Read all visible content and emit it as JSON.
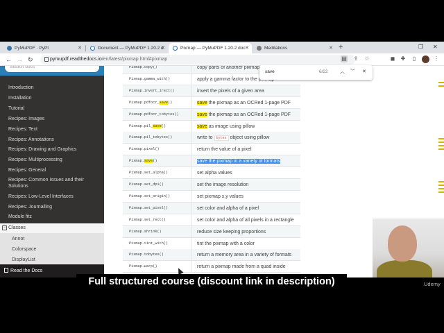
{
  "browser": {
    "tabs": [
      {
        "label": "PyMuPDF · PyPI"
      },
      {
        "label": "Document — PyMuPDF 1.20.2 d"
      },
      {
        "label": "Pixmap — PyMuPDF 1.20.2 doc"
      },
      {
        "label": "Meditations"
      }
    ],
    "url_host": "pymupdf.readthedocs.io",
    "url_path": "/en/latest/pixmap.html#pixmap",
    "new_tab_label": "+"
  },
  "find_bar": {
    "query": "save",
    "count": "6/22"
  },
  "sidebar": {
    "search_placeholder": "Search docs",
    "items": [
      {
        "label": "Introduction"
      },
      {
        "label": "Installation"
      },
      {
        "label": "Tutorial"
      },
      {
        "label": "Recipes: Images"
      },
      {
        "label": "Recipes: Text"
      },
      {
        "label": "Recipes: Annotations"
      },
      {
        "label": "Recipes: Drawing and Graphics"
      },
      {
        "label": "Recipes: Multiprocessing"
      },
      {
        "label": "Recipes: General"
      },
      {
        "label": "Recipes: Common Issues and their Solutions"
      },
      {
        "label": "Recipes: Low-Level Interfaces"
      },
      {
        "label": "Recipes: Journalling"
      },
      {
        "label": "Module fitz"
      }
    ],
    "classes_label": "Classes",
    "toggle_symbol": "−",
    "sub_items": [
      {
        "label": "Annot"
      },
      {
        "label": "Colorspace"
      },
      {
        "label": "DisplayList"
      }
    ],
    "read_the_docs": "Read the Docs"
  },
  "methods_table": {
    "rows": [
      {
        "name": "Pixmap.copy()",
        "pre": "copy parts of another pixmap",
        "hl": "",
        "post": "",
        "highlight": "none"
      },
      {
        "name": "Pixmap.gamma_with()",
        "pre": "apply a gamma factor to the pixmap",
        "hl": "",
        "post": "",
        "highlight": "none"
      },
      {
        "name": "Pixmap.invert_irect()",
        "pre": "invert the pixels of a given area",
        "hl": "",
        "post": "",
        "highlight": "none"
      },
      {
        "name_pre": "Pixmap.pdfocr_",
        "name_hl": "save",
        "name_post": "()",
        "pre": "",
        "hl": "save",
        "post": " the pixmap as an OCRed 1-page PDF",
        "highlight": "yellow"
      },
      {
        "name": "Pixmap.pdfocr_tobytes()",
        "pre": "",
        "hl": "save",
        "post": " the pixmap as an OCRed 1-page PDF",
        "highlight": "yellow"
      },
      {
        "name_pre": "Pixmap.pil_",
        "name_hl": "save",
        "name_post": "()",
        "pre": "",
        "hl": "save",
        "post": " as image using pillow",
        "highlight": "yellow"
      },
      {
        "name": "Pixmap.pil_tobytes()",
        "pre": "write to ",
        "lit": "bytes",
        "post": " object using pillow",
        "highlight": "literal"
      },
      {
        "name": "Pixmap.pixel()",
        "pre": "return the value of a pixel",
        "hl": "",
        "post": "",
        "highlight": "none"
      },
      {
        "name_pre": "Pixmap.",
        "name_hl": "save",
        "name_post": "()",
        "pre": "",
        "hl": "save the pixmap in a variety of formats",
        "post": "",
        "highlight": "selected"
      },
      {
        "name": "Pixmap.set_alpha()",
        "pre": "set alpha values",
        "hl": "",
        "post": "",
        "highlight": "none"
      },
      {
        "name": "Pixmap.set_dpi()",
        "pre": "set the image resolution",
        "hl": "",
        "post": "",
        "highlight": "none"
      },
      {
        "name": "Pixmap.set_origin()",
        "pre": "set pixmap x,y values",
        "hl": "",
        "post": "",
        "highlight": "none"
      },
      {
        "name": "Pixmap.set_pixel()",
        "pre": "set color and alpha of a pixel",
        "hl": "",
        "post": "",
        "highlight": "none"
      },
      {
        "name": "Pixmap.set_rect()",
        "pre": "set color and alpha of all pixels in a rectangle",
        "hl": "",
        "post": "",
        "highlight": "none"
      },
      {
        "name": "Pixmap.shrink()",
        "pre": "reduce size keeping proportions",
        "hl": "",
        "post": "",
        "highlight": "none"
      },
      {
        "name": "Pixmap.tint_with()",
        "pre": "tint the pixmap with a color",
        "hl": "",
        "post": "",
        "highlight": "none"
      },
      {
        "name": "Pixmap.tobytes()",
        "pre": "return a memory area in a variety of formats",
        "hl": "",
        "post": "",
        "highlight": "none"
      },
      {
        "name": "Pixmap.warp()",
        "pre": "return a pixmap made from a quad inside",
        "hl": "",
        "post": "",
        "highlight": "none"
      }
    ]
  },
  "overlay": {
    "caption": "Full structured course (discount link in description)",
    "watermark": "Udemy"
  },
  "colors": {
    "sidebar_bg": "#343131",
    "search_band": "#2980b9",
    "highlight": "#ffee00",
    "selection": "#3f8ef0"
  }
}
